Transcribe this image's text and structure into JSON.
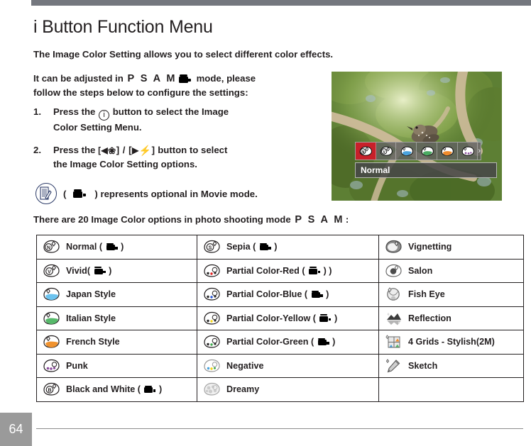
{
  "page": {
    "title": "i Button Function Menu",
    "number": "64",
    "intro": "The Image Color Setting allows you to select different color effects.",
    "adjust_prefix": "It can be adjusted in",
    "mode_letters": "P S A M",
    "adjust_suffix": "mode, please",
    "adjust_line2": "follow the steps below to configure the settings:",
    "count_line_prefix": "There are 20 Image Color options in photo shooting mode",
    "count_line_suffix": ":"
  },
  "steps": [
    {
      "num": "1.",
      "part1": "Press the",
      "button": "i",
      "part2": "button to select the Image",
      "line2": "Color Setting Menu."
    },
    {
      "num": "2.",
      "part1": "Press the",
      "key_left": "[◀",
      "key_left_icon": "macro-flower-icon",
      "key_sep": "] / [",
      "key_right": "▶",
      "key_right_icon": "flash-icon",
      "key_close": "]",
      "part2": "button to select",
      "line2": "the Image Color Setting options."
    }
  ],
  "note": {
    "icon": "notepad-pencil-icon",
    "open_paren": "(",
    "movie_icon": "movie-mode-icon",
    "text": ") represents optional in Movie mode."
  },
  "preview": {
    "scene": "bird-on-branch-photo",
    "selected_label": "Normal",
    "osd_icons": [
      {
        "name": "normal-palette-icon",
        "letter": "N",
        "selected": true
      },
      {
        "name": "vivid-palette-icon",
        "letter": "V",
        "selected": false
      },
      {
        "name": "japan-style-palette-icon",
        "color": "#4aa3dd",
        "selected": false
      },
      {
        "name": "italian-style-palette-icon",
        "color": "#4aab62",
        "selected": false
      },
      {
        "name": "french-style-palette-icon",
        "color": "#ef8b2c",
        "selected": false
      },
      {
        "name": "punk-palette-icon",
        "color": "#8c4f9e",
        "selected": false
      }
    ],
    "more_arrow": "›"
  },
  "table": {
    "rows": [
      {
        "c1": {
          "icon": "normal-palette-icon",
          "label": "Normal",
          "movie": true,
          "paren_extra": false
        },
        "c2": {
          "icon": "sepia-palette-icon",
          "label": "Sepia",
          "movie": true,
          "paren_extra": false
        },
        "c3": {
          "icon": "vignetting-icon",
          "label": "Vignetting",
          "movie": false
        }
      },
      {
        "c1": {
          "icon": "vivid-palette-icon",
          "label": "Vivid",
          "movie": true,
          "tight": true
        },
        "c2": {
          "icon": "partial-color-red-icon",
          "label": "Partial Color-Red",
          "movie": true,
          "paren_extra": true
        },
        "c3": {
          "icon": "salon-icon",
          "label": "Salon",
          "movie": false
        }
      },
      {
        "c1": {
          "icon": "japan-style-palette-icon",
          "label": "Japan Style",
          "movie": false
        },
        "c2": {
          "icon": "partial-color-blue-icon",
          "label": "Partial Color-Blue",
          "movie": true
        },
        "c3": {
          "icon": "fish-eye-icon",
          "label": "Fish Eye",
          "movie": false
        }
      },
      {
        "c1": {
          "icon": "italian-style-palette-icon",
          "label": "Italian Style",
          "movie": false
        },
        "c2": {
          "icon": "partial-color-yellow-icon",
          "label": "Partial Color-Yellow",
          "movie": true
        },
        "c3": {
          "icon": "reflection-icon",
          "label": "Reflection",
          "movie": false
        }
      },
      {
        "c1": {
          "icon": "french-style-palette-icon",
          "label": "French Style",
          "movie": false
        },
        "c2": {
          "icon": "partial-color-green-icon",
          "label": "Partial Color-Green",
          "movie": true
        },
        "c3": {
          "icon": "four-grids-stylish-icon",
          "label": "4 Grids - Stylish(2M)",
          "movie": false
        }
      },
      {
        "c1": {
          "icon": "punk-palette-icon",
          "label": "Punk",
          "movie": false
        },
        "c2": {
          "icon": "negative-palette-icon",
          "label": "Negative",
          "movie": false
        },
        "c3": {
          "icon": "sketch-icon",
          "label": "Sketch",
          "movie": false
        }
      },
      {
        "c1": {
          "icon": "black-and-white-palette-icon",
          "label": "Black and White",
          "movie": true
        },
        "c2": {
          "icon": "dreamy-palette-icon",
          "label": "Dreamy",
          "movie": false
        },
        "c3": {
          "icon": "",
          "label": "",
          "movie": false
        }
      }
    ]
  },
  "colors": {
    "top_bar": "#74777e",
    "page_box": "#9a9a9a",
    "osd_selected": "#c8202a",
    "note_ring": "#2b3a67",
    "text": "#231f20"
  }
}
